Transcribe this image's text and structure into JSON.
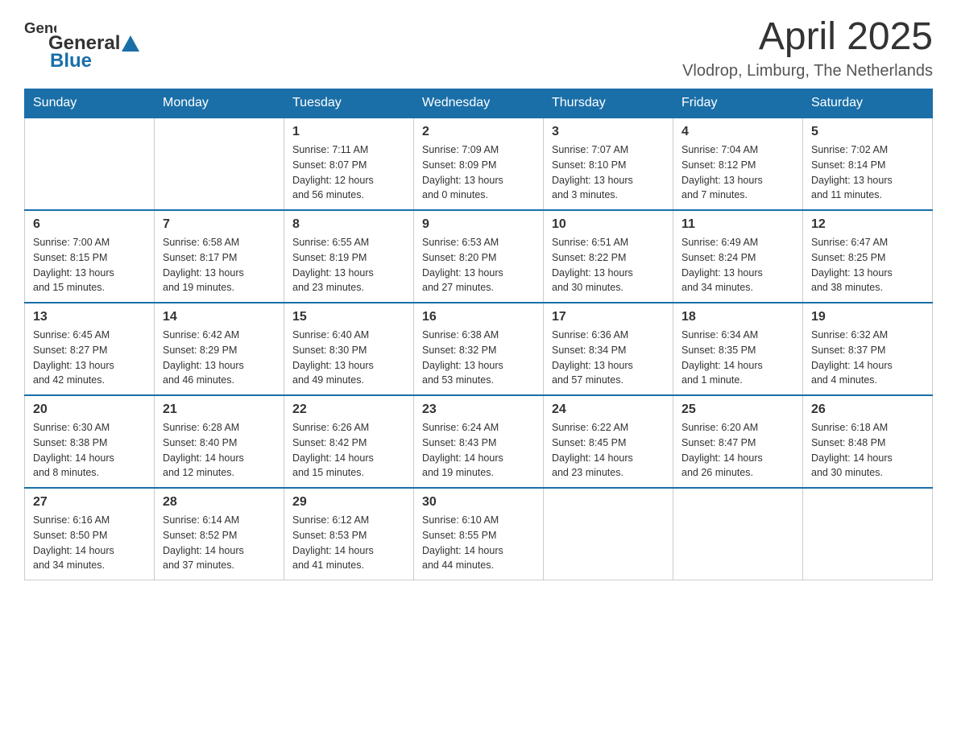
{
  "header": {
    "logo_general": "General",
    "logo_blue": "Blue",
    "title": "April 2025",
    "location": "Vlodrop, Limburg, The Netherlands"
  },
  "days_of_week": [
    "Sunday",
    "Monday",
    "Tuesday",
    "Wednesday",
    "Thursday",
    "Friday",
    "Saturday"
  ],
  "weeks": [
    [
      {
        "day": "",
        "info": ""
      },
      {
        "day": "",
        "info": ""
      },
      {
        "day": "1",
        "info": "Sunrise: 7:11 AM\nSunset: 8:07 PM\nDaylight: 12 hours\nand 56 minutes."
      },
      {
        "day": "2",
        "info": "Sunrise: 7:09 AM\nSunset: 8:09 PM\nDaylight: 13 hours\nand 0 minutes."
      },
      {
        "day": "3",
        "info": "Sunrise: 7:07 AM\nSunset: 8:10 PM\nDaylight: 13 hours\nand 3 minutes."
      },
      {
        "day": "4",
        "info": "Sunrise: 7:04 AM\nSunset: 8:12 PM\nDaylight: 13 hours\nand 7 minutes."
      },
      {
        "day": "5",
        "info": "Sunrise: 7:02 AM\nSunset: 8:14 PM\nDaylight: 13 hours\nand 11 minutes."
      }
    ],
    [
      {
        "day": "6",
        "info": "Sunrise: 7:00 AM\nSunset: 8:15 PM\nDaylight: 13 hours\nand 15 minutes."
      },
      {
        "day": "7",
        "info": "Sunrise: 6:58 AM\nSunset: 8:17 PM\nDaylight: 13 hours\nand 19 minutes."
      },
      {
        "day": "8",
        "info": "Sunrise: 6:55 AM\nSunset: 8:19 PM\nDaylight: 13 hours\nand 23 minutes."
      },
      {
        "day": "9",
        "info": "Sunrise: 6:53 AM\nSunset: 8:20 PM\nDaylight: 13 hours\nand 27 minutes."
      },
      {
        "day": "10",
        "info": "Sunrise: 6:51 AM\nSunset: 8:22 PM\nDaylight: 13 hours\nand 30 minutes."
      },
      {
        "day": "11",
        "info": "Sunrise: 6:49 AM\nSunset: 8:24 PM\nDaylight: 13 hours\nand 34 minutes."
      },
      {
        "day": "12",
        "info": "Sunrise: 6:47 AM\nSunset: 8:25 PM\nDaylight: 13 hours\nand 38 minutes."
      }
    ],
    [
      {
        "day": "13",
        "info": "Sunrise: 6:45 AM\nSunset: 8:27 PM\nDaylight: 13 hours\nand 42 minutes."
      },
      {
        "day": "14",
        "info": "Sunrise: 6:42 AM\nSunset: 8:29 PM\nDaylight: 13 hours\nand 46 minutes."
      },
      {
        "day": "15",
        "info": "Sunrise: 6:40 AM\nSunset: 8:30 PM\nDaylight: 13 hours\nand 49 minutes."
      },
      {
        "day": "16",
        "info": "Sunrise: 6:38 AM\nSunset: 8:32 PM\nDaylight: 13 hours\nand 53 minutes."
      },
      {
        "day": "17",
        "info": "Sunrise: 6:36 AM\nSunset: 8:34 PM\nDaylight: 13 hours\nand 57 minutes."
      },
      {
        "day": "18",
        "info": "Sunrise: 6:34 AM\nSunset: 8:35 PM\nDaylight: 14 hours\nand 1 minute."
      },
      {
        "day": "19",
        "info": "Sunrise: 6:32 AM\nSunset: 8:37 PM\nDaylight: 14 hours\nand 4 minutes."
      }
    ],
    [
      {
        "day": "20",
        "info": "Sunrise: 6:30 AM\nSunset: 8:38 PM\nDaylight: 14 hours\nand 8 minutes."
      },
      {
        "day": "21",
        "info": "Sunrise: 6:28 AM\nSunset: 8:40 PM\nDaylight: 14 hours\nand 12 minutes."
      },
      {
        "day": "22",
        "info": "Sunrise: 6:26 AM\nSunset: 8:42 PM\nDaylight: 14 hours\nand 15 minutes."
      },
      {
        "day": "23",
        "info": "Sunrise: 6:24 AM\nSunset: 8:43 PM\nDaylight: 14 hours\nand 19 minutes."
      },
      {
        "day": "24",
        "info": "Sunrise: 6:22 AM\nSunset: 8:45 PM\nDaylight: 14 hours\nand 23 minutes."
      },
      {
        "day": "25",
        "info": "Sunrise: 6:20 AM\nSunset: 8:47 PM\nDaylight: 14 hours\nand 26 minutes."
      },
      {
        "day": "26",
        "info": "Sunrise: 6:18 AM\nSunset: 8:48 PM\nDaylight: 14 hours\nand 30 minutes."
      }
    ],
    [
      {
        "day": "27",
        "info": "Sunrise: 6:16 AM\nSunset: 8:50 PM\nDaylight: 14 hours\nand 34 minutes."
      },
      {
        "day": "28",
        "info": "Sunrise: 6:14 AM\nSunset: 8:52 PM\nDaylight: 14 hours\nand 37 minutes."
      },
      {
        "day": "29",
        "info": "Sunrise: 6:12 AM\nSunset: 8:53 PM\nDaylight: 14 hours\nand 41 minutes."
      },
      {
        "day": "30",
        "info": "Sunrise: 6:10 AM\nSunset: 8:55 PM\nDaylight: 14 hours\nand 44 minutes."
      },
      {
        "day": "",
        "info": ""
      },
      {
        "day": "",
        "info": ""
      },
      {
        "day": "",
        "info": ""
      }
    ]
  ]
}
